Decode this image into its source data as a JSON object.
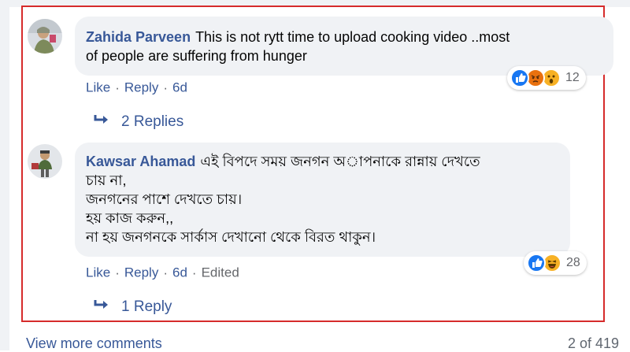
{
  "comments": [
    {
      "author": "Zahida Parveen",
      "text_lines": [
        "This is not rytt time to upload cooking video ..most",
        "of people are suffering from hunger"
      ],
      "actions": {
        "like": "Like",
        "reply": "Reply",
        "time": "6d"
      },
      "reactions": {
        "icons": [
          "like-icon",
          "angry-icon",
          "wow-icon"
        ],
        "count": "12"
      },
      "replies_label": "2 Replies"
    },
    {
      "author": "Kawsar Ahamad",
      "text_lines": [
        "এই বিপদে সময় জনগন অাপনাকে রান্নায় দেখতে",
        "চায় না,",
        "জনগনের পাশে দেখতে চায়।",
        "হয় কাজ করুন,,",
        "না হয় জনগনকে সার্কাস দেখানো থেকে বিরত থাকুন।"
      ],
      "actions": {
        "like": "Like",
        "reply": "Reply",
        "time": "6d",
        "edited": "Edited"
      },
      "reactions": {
        "icons": [
          "like-icon",
          "haha-icon"
        ],
        "count": "28"
      },
      "replies_label": "1 Reply"
    }
  ],
  "footer": {
    "view_more": "View more comments",
    "pagination": "2 of 419"
  },
  "colors": {
    "highlight": "#d62b2b",
    "link": "#385898",
    "bubble": "#f0f2f5",
    "like": "#1877f2",
    "angry": "#e9710f",
    "wow": "#f7b125"
  }
}
